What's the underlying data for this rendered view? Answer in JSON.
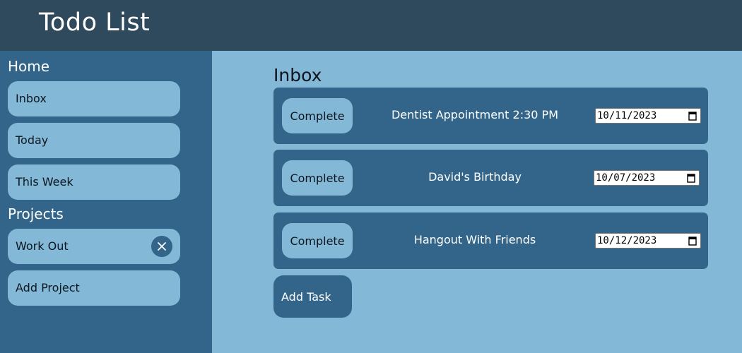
{
  "header": {
    "title": "Todo List"
  },
  "sidebar": {
    "home_heading": "Home",
    "home_items": [
      {
        "label": "Inbox"
      },
      {
        "label": "Today"
      },
      {
        "label": "This Week"
      }
    ],
    "projects_heading": "Projects",
    "projects": [
      {
        "label": "Work Out",
        "remove_icon": "close-icon"
      }
    ],
    "add_project_label": "Add Project"
  },
  "main": {
    "title": "Inbox",
    "tasks": [
      {
        "complete_label": "Complete",
        "name": "Dentist Appointment 2:30 PM",
        "date": "10/11/2023"
      },
      {
        "complete_label": "Complete",
        "name": "David's Birthday",
        "date": "10/07/2023"
      },
      {
        "complete_label": "Complete",
        "name": "Hangout With Friends",
        "date": "10/12/2023"
      }
    ],
    "add_task_label": "Add Task"
  },
  "colors": {
    "header_bg": "#2f4a5c",
    "sidebar_bg": "#326589",
    "main_bg": "#83b8d6",
    "task_bg": "#326589"
  }
}
